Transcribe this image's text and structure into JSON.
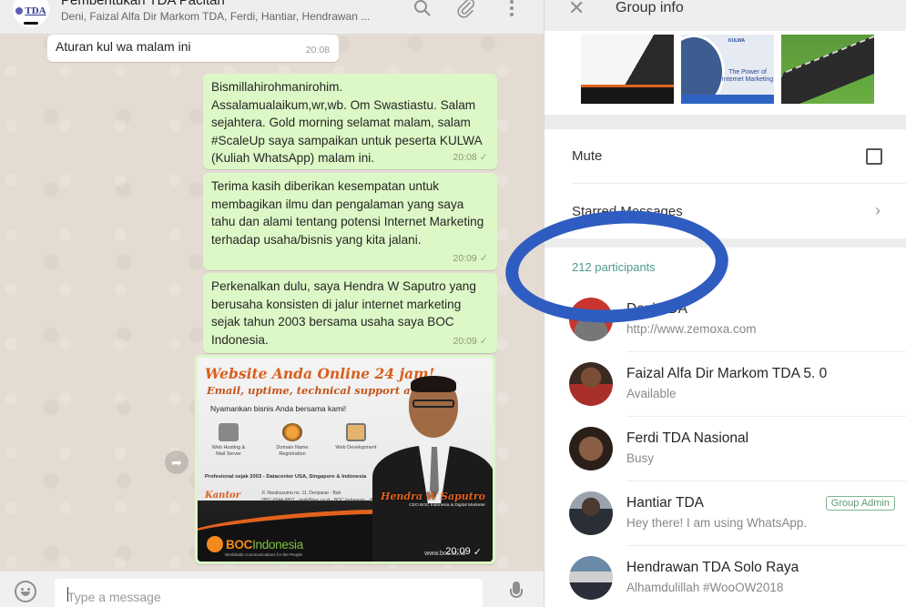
{
  "chat": {
    "title": "Pembentukan TDA Pacitan",
    "subtitle": "Deni, Faizal Alfa Dir Markom TDA, Ferdi, Hantiar, Hendrawan ...",
    "avatar_logo": "TDA",
    "header_icons": [
      "search-icon",
      "paperclip-icon",
      "menu-dots-icon"
    ],
    "messages": [
      {
        "direction": "in",
        "text": "Aturan kul wa malam ini",
        "time": "20:08"
      },
      {
        "direction": "out",
        "text": "Bismillahirohmanirohim.\nAssalamualaikum,wr,wb. Om Swastiastu. Salam sejahtera. Gold morning selamat malam, salam #ScaleUp saya sampaikan untuk peserta KULWA (Kuliah WhatsApp) malam ini.",
        "time": "20:08",
        "status": "✓"
      },
      {
        "direction": "out",
        "text": "Terima kasih diberikan kesempatan untuk membagikan ilmu dan pengalaman yang saya tahu dan alami tentang potensi Internet Marketing terhadap usaha/bisnis yang kita jalani.",
        "time": "20:09",
        "status": "✓"
      },
      {
        "direction": "out",
        "text": "Perkenalkan dulu, saya Hendra W Saputro yang berusaha konsisten di jalur internet marketing sejak tahun 2003 bersama usaha saya BOC Indonesia.",
        "time": "20:09",
        "status": "✓"
      }
    ],
    "image_message": {
      "time": "20:09",
      "status": "✓",
      "banner": {
        "headline": "Website Anda Online 24 jam!",
        "subheadline": "Email, uptime, technical support aman!",
        "tagline": "Nyamankan bisnis Anda bersama kami!",
        "services": [
          "Web Hosting & Mail Server",
          "Domain Name Registration",
          "Web Development"
        ],
        "professional": "Profesional sejak 2003 - Datacenter USA, Singapore & Indonesia",
        "office_label": "Kantor",
        "address": "Jl. Narakusuma no. 11, Denpasar - Bali",
        "contacts": "0851-0044-8807 · mail@boc.co.id · BOC Indonesia · @idboc · bocjoss",
        "brand": "BOC",
        "brand_suffix": "Indonesia",
        "brand_tagline": "Worldwide Communications for the People",
        "person_name": "Hendra W Saputro",
        "person_title": "CEO BOC Indonesia & Digital Marketer",
        "url": "www.boc.co.id"
      }
    },
    "composer": {
      "placeholder": "Type a message"
    }
  },
  "group_info": {
    "title": "Group info",
    "settings": {
      "mute_label": "Mute",
      "mute_checked": false,
      "starred_label": "Starred Messages"
    },
    "media_thumbs": [
      {
        "name": "boc-banner-thumb"
      },
      {
        "name": "kulwa-thumb",
        "title": "KULWA",
        "caption": "The Power of Internet Marketing"
      },
      {
        "name": "road-carpet-thumb"
      }
    ],
    "participants_count": "212 participants",
    "participants": [
      {
        "name": "Deni TDA",
        "status": "http://www.zemoxa.com",
        "admin": false
      },
      {
        "name": "Faizal Alfa Dir Markom TDA 5. 0",
        "status": "Available",
        "admin": false
      },
      {
        "name": "Ferdi TDA Nasional",
        "status": "Busy",
        "admin": false
      },
      {
        "name": "Hantiar TDA",
        "status": "Hey there! I am using WhatsApp.",
        "admin": true,
        "badge": "Group Admin"
      },
      {
        "name": "Hendrawan TDA Solo Raya",
        "status": "Alhamdulillah #WooOW2018",
        "admin": false
      }
    ]
  },
  "colors": {
    "outgoing_bubble": "#dcf8c6",
    "incoming_bubble": "#ffffff",
    "participants_count": "#4e9a8a",
    "admin_badge": "#5e9a70",
    "annotation_circle": "#2f5cc0"
  }
}
